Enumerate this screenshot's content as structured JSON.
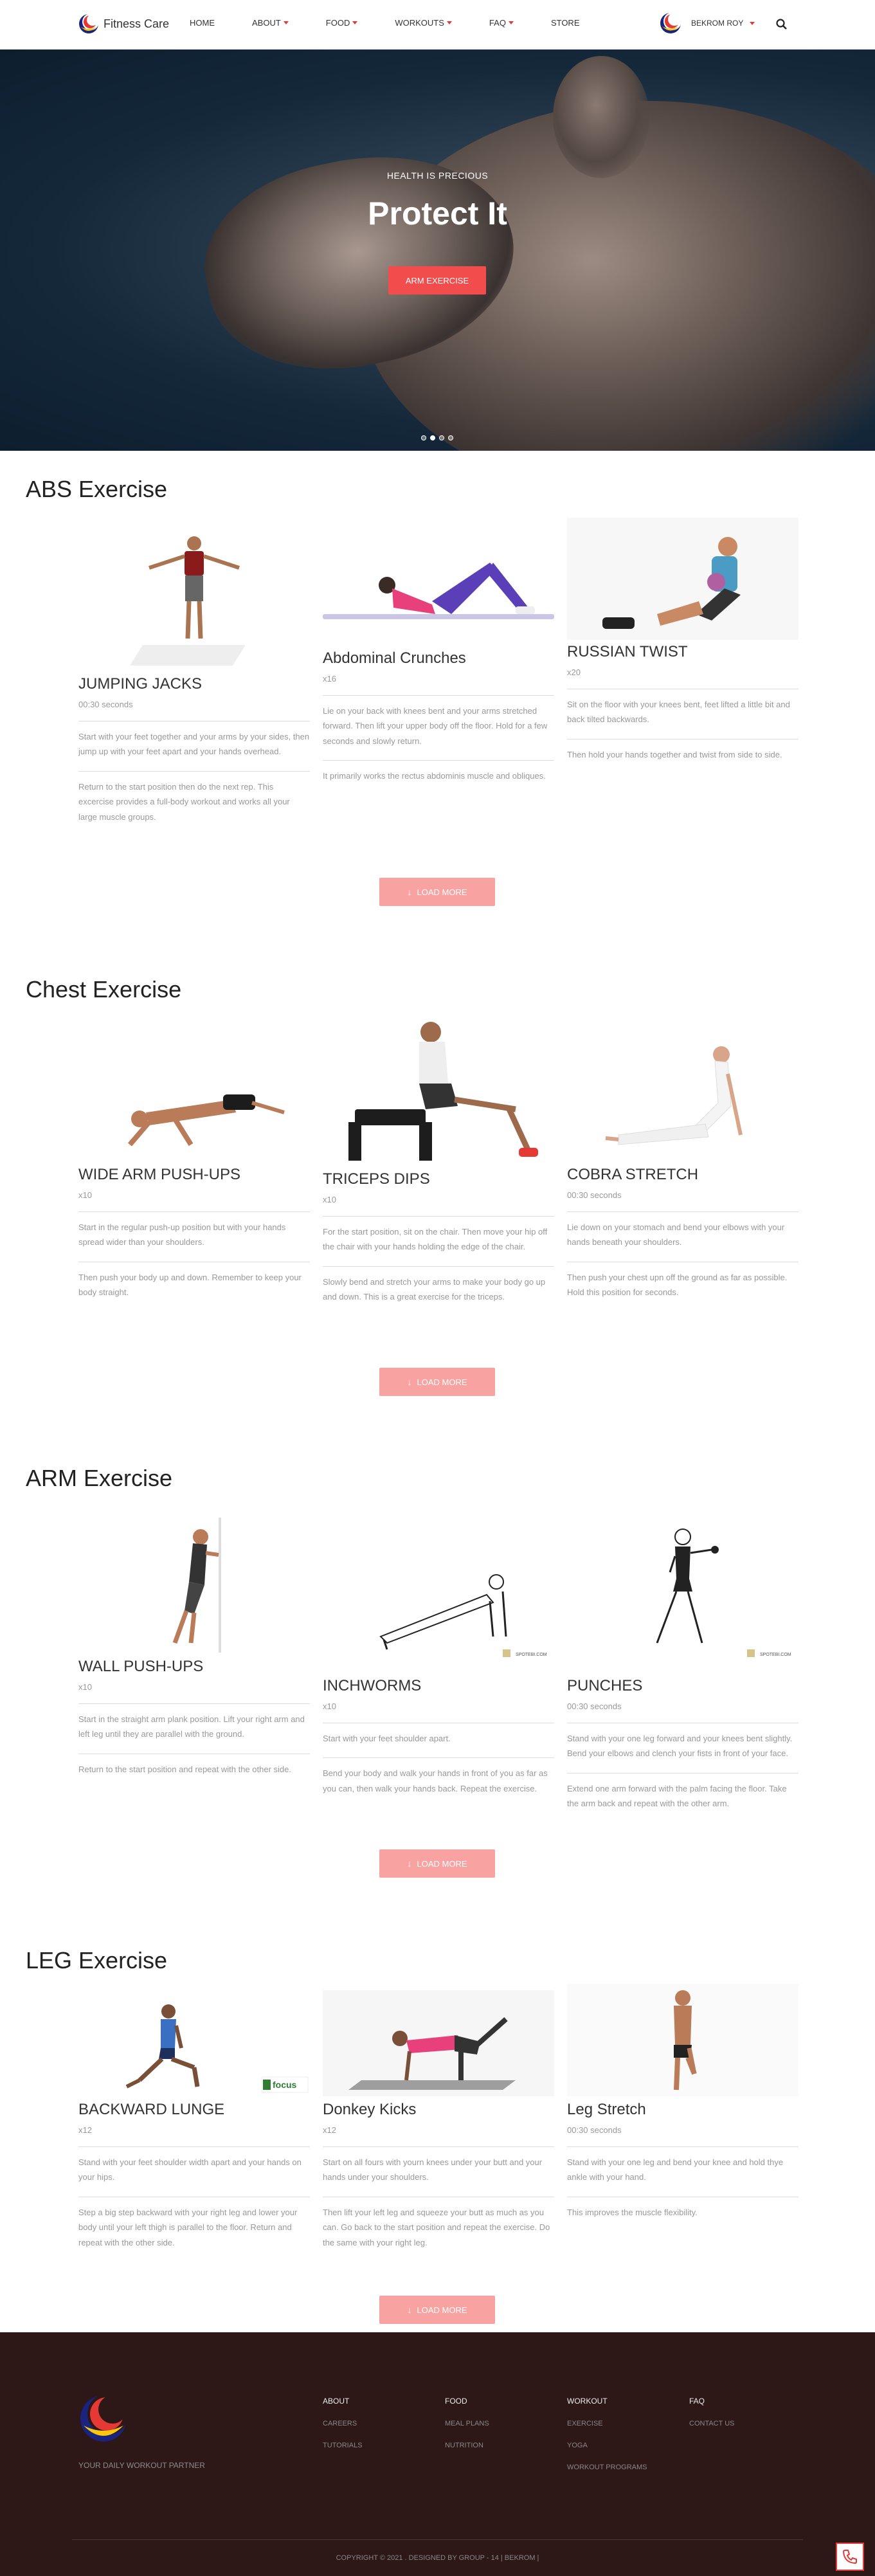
{
  "nav": {
    "brand": "Fitness Care",
    "links": [
      "HOME",
      "ABOUT",
      "FOOD",
      "WORKOUTS",
      "FAQ",
      "STORE"
    ],
    "user": "BEKROM ROY",
    "colors": {
      "accent": "#e53935",
      "navy": "#1a237e",
      "yellow": "#f9c80e"
    }
  },
  "hero": {
    "kicker": "HEALTH IS PRECIOUS",
    "title": "Protect It",
    "button": "ARM EXERCISE",
    "slides": 4,
    "active_slide": 1
  },
  "sections": [
    {
      "title": "ABS Exercise",
      "load_more": "LOAD MORE",
      "cards": [
        {
          "name": "JUMPING JACKS",
          "meta": "00:30 seconds",
          "p1": "Start with your feet together and your arms by your sides, then jump up with your feet apart and your hands overhead.",
          "p2": "Return to the start position then do the next rep. This excercise provides a full-body workout and works all your large muscle groups."
        },
        {
          "name": "Abdominal Crunches",
          "meta": "x16",
          "p1": "Lie on your back with knees bent and your arms stretched forward. Then lift your upper body off the floor. Hold for a few seconds and slowly return.",
          "p2": "It primarily works the rectus abdominis muscle and obliques."
        },
        {
          "name": "RUSSIAN TWIST",
          "meta": "x20",
          "p1": "Sit on the floor with your knees bent, feet lifted a little bit and back tilted backwards.",
          "p2": "Then hold your hands together and twist from side to side."
        }
      ]
    },
    {
      "title": "Chest Exercise",
      "load_more": "LOAD MORE",
      "cards": [
        {
          "name": "WIDE ARM PUSH-UPS",
          "meta": "x10",
          "p1": "Start in the regular push-up position but with your hands spread wider than your shoulders.",
          "p2": "Then push your body up and down. Remember to keep your body straight."
        },
        {
          "name": "TRICEPS DIPS",
          "meta": "x10",
          "p1": "For the start position, sit on the chair. Then move your hip off the chair with your hands holding the edge of the chair.",
          "p2": "Slowly bend and stretch your arms to make your body go up and down. This is a great exercise for the triceps."
        },
        {
          "name": "COBRA STRETCH",
          "meta": "00:30 seconds",
          "p1": "Lie down on your stomach and bend your elbows with your hands beneath your shoulders.",
          "p2": "Then push your chest upn off the ground as far as possible. Hold this position for seconds."
        }
      ]
    },
    {
      "title": "ARM Exercise",
      "load_more": "LOAD MORE",
      "cards": [
        {
          "name": "WALL PUSH-UPS",
          "meta": "x10",
          "p1": "Start in the straight arm plank position. Lift your right arm and left leg until they are parallel with the ground.",
          "p2": "Return to the start position and repeat with the other side."
        },
        {
          "name": "INCHWORMS",
          "meta": "x10",
          "watermark": "SPOTEBI.COM",
          "p1": "Start with your feet shoulder apart.",
          "p2": "Bend your body and walk your hands in front of you as far as you can, then walk your hands back. Repeat the exercise."
        },
        {
          "name": "PUNCHES",
          "meta": "00:30 seconds",
          "watermark": "SPOTEBI.COM",
          "p1": "Stand with your one leg forward and your knees bent slightly. Bend your elbows and clench your fists in front of your face.",
          "p2": "Extend one arm forward with the palm facing the floor. Take the arm back and repeat with the other arm."
        }
      ]
    },
    {
      "title": "LEG Exercise",
      "load_more": "LOAD MORE",
      "cards": [
        {
          "name": "BACKWARD LUNGE",
          "meta": "x12",
          "watermark": "focus",
          "p1": "Stand with your feet shoulder width apart and your hands on your hips.",
          "p2": "Step a big step backward with your right leg and lower your body until your left thigh is parallel to the floor. Return and repeat with the other side."
        },
        {
          "name": "Donkey Kicks",
          "meta": "x12",
          "p1": "Start on all fours with yourn knees under your butt and your hands under your shoulders.",
          "p2": "Then lift your left leg and squeeze your butt as much as you can. Go back to the start position and repeat the exercise. Do the same with your right leg."
        },
        {
          "name": "Leg Stretch",
          "meta": "00:30 seconds",
          "p1": "Stand with your one leg and bend your knee and hold thye ankle with your hand.",
          "p2": "This improves the muscle flexibility."
        }
      ]
    }
  ],
  "footer": {
    "tagline": "YOUR DAILY WORKOUT PARTNER",
    "columns": [
      {
        "head": "ABOUT",
        "links": [
          "CAREERS",
          "TUTORIALS"
        ]
      },
      {
        "head": "FOOD",
        "links": [
          "MEAL PLANS",
          "NUTRITION"
        ]
      },
      {
        "head": "WORKOUT",
        "links": [
          "EXERCISE",
          "YOGA",
          "WORKOUT PROGRAMS"
        ]
      },
      {
        "head": "FAQ",
        "links": [
          "CONTACT US"
        ]
      }
    ],
    "copyright": "COPYRIGHT © 2021 . DESIGNED BY GROUP - 14 | BEKROM |"
  }
}
